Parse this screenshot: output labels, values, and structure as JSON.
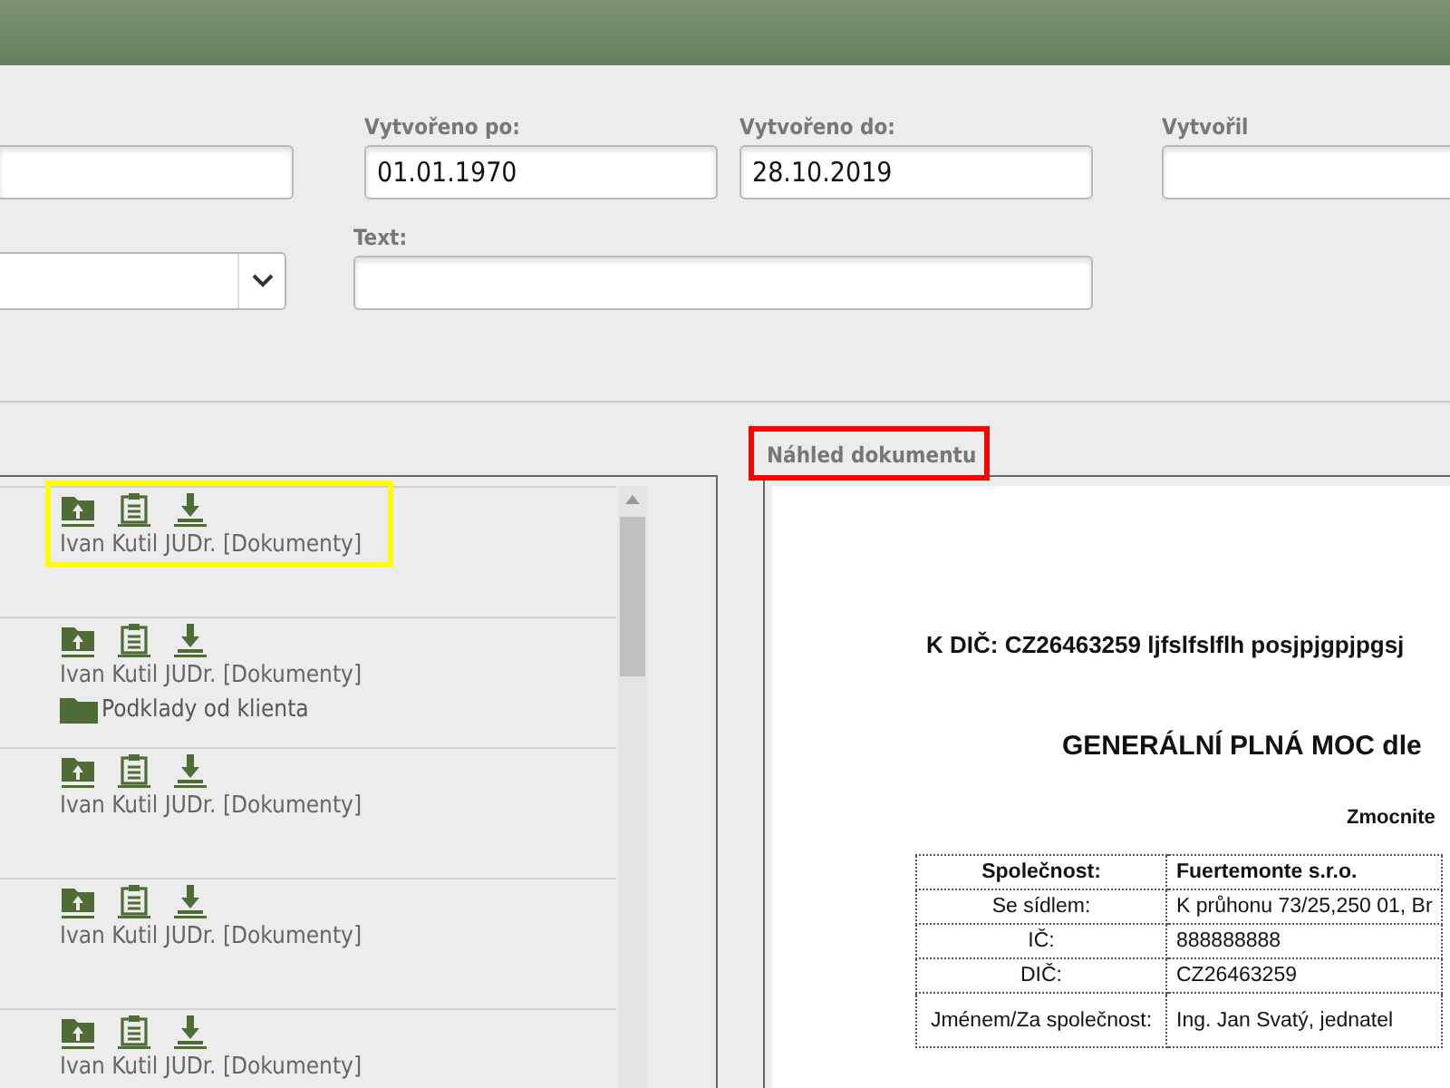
{
  "filters": [
    {
      "kind": "input"
    },
    {
      "kind": "input",
      "label": "Vytvořeno po:",
      "value": "01.01.1970"
    },
    {
      "kind": "input",
      "label": "Vytvořeno do:",
      "value": "28.10.2019"
    },
    {
      "kind": "input",
      "label": "Vytvořil"
    },
    {
      "kind": "select"
    },
    {
      "kind": "input",
      "label": "Text:"
    }
  ],
  "documents": [
    {
      "author": "Ivan Kutil JUDr. [Dokumenty]",
      "color": "#ffff00"
    },
    {
      "author": "Ivan Kutil JUDr. [Dokumenty]",
      "folder": "Podklady od klienta"
    },
    {
      "author": "Ivan Kutil JUDr. [Dokumenty]"
    },
    {
      "author": "Ivan Kutil JUDr. [Dokumenty]"
    },
    {
      "author": "Ivan Kutil JUDr. [Dokumenty]"
    }
  ],
  "preview": {
    "heading": {
      "text": "Náhled dokumentu",
      "color": "#ff0000"
    },
    "document": {
      "reference": "K DIČ: CZ26463259 ljfslfslflh posjpjgpjpgsj",
      "title": "GENERÁLNÍ PLNÁ MOC dle",
      "party_heading": "Zmocnite",
      "table": [
        {
          "label": "Společnost:",
          "value": "Fuertemonte s.r.o."
        },
        {
          "label": "Se sídlem:",
          "value": "K průhonu 73/25,250 01, Br"
        },
        {
          "label": "IČ:",
          "value": "888888888"
        },
        {
          "label": "DIČ:",
          "value": "CZ26463259"
        },
        {
          "label": "Jménem/Za společnost:",
          "value": "Ing. Jan Svatý, jednatel"
        }
      ]
    }
  }
}
